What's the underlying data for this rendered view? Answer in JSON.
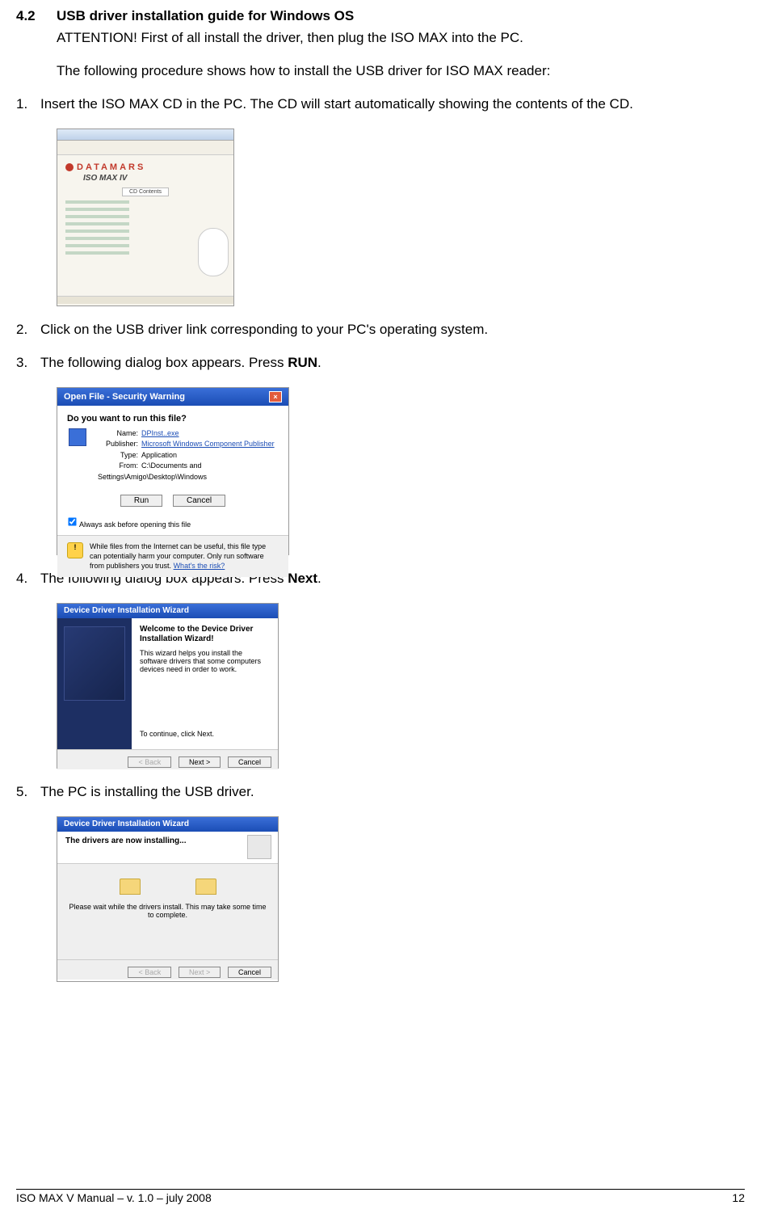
{
  "section": {
    "number": "4.2",
    "title": "USB driver installation guide for Windows OS"
  },
  "intro": {
    "attention": "ATTENTION! First of all install the driver, then plug the ISO MAX into the PC.",
    "procedure": "The following procedure shows how to install the USB driver for ISO MAX reader:"
  },
  "steps": [
    {
      "num": "1.",
      "text": "Insert the ISO MAX CD in the PC. The CD will start automatically showing the contents of the CD."
    },
    {
      "num": "2.",
      "text": "Click on the USB driver link corresponding to your PC's operating system."
    },
    {
      "num": "3.",
      "text_pre": "The following dialog box appears. Press ",
      "bold": "RUN",
      "text_post": "."
    },
    {
      "num": "4.",
      "text_pre": "The following dialog box appears. Press ",
      "bold": "Next",
      "text_post": "."
    },
    {
      "num": "5.",
      "text": "The PC is installing the USB driver."
    }
  ],
  "fig1": {
    "brand": "ATAMARS",
    "subtitle": "ISO MAX IV",
    "contents_btn": "CD Contents"
  },
  "fig2": {
    "title": "Open File - Security Warning",
    "question": "Do you want to run this file?",
    "name_lbl": "Name:",
    "name_val": "DPInst..exe",
    "pub_lbl": "Publisher:",
    "pub_val": "Microsoft Windows Component Publisher",
    "type_lbl": "Type:",
    "type_val": "Application",
    "from_lbl": "From:",
    "from_val": "C:\\Documents and Settings\\Amigo\\Desktop\\Windows",
    "run_btn": "Run",
    "cancel_btn": "Cancel",
    "always_ask": "Always ask before opening this file",
    "warn": "While files from the Internet can be useful, this file type can potentially harm your computer. Only run software from publishers you trust.",
    "warn_link": "What's the risk?"
  },
  "fig3": {
    "title": "Device Driver Installation Wizard",
    "h": "Welcome to the Device Driver Installation Wizard!",
    "desc": "This wizard helps you install the software drivers that some computers devices need in order to work.",
    "cont": "To continue, click Next.",
    "back_btn": "< Back",
    "next_btn": "Next >",
    "cancel_btn": "Cancel"
  },
  "fig4": {
    "title": "Device Driver Installation Wizard",
    "h": "The drivers are now installing...",
    "wait": "Please wait while the drivers install. This may take some time to complete.",
    "back_btn": "< Back",
    "next_btn": "Next >",
    "cancel_btn": "Cancel"
  },
  "footer": {
    "left": "ISO MAX V Manual – v. 1.0 – july 2008",
    "right": "12"
  }
}
